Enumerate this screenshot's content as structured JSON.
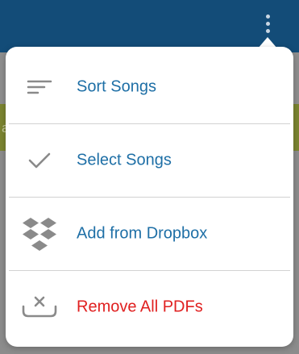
{
  "header": {
    "more_icon": "more-vertical-icon",
    "background_color": "#134c78"
  },
  "background": {
    "band_color": "#7b8430",
    "peek_text": "a"
  },
  "menu": {
    "items": [
      {
        "label": "Sort Songs",
        "icon": "sort-icon",
        "color": "#1e6fa6"
      },
      {
        "label": "Select Songs",
        "icon": "checkmark-icon",
        "color": "#1e6fa6"
      },
      {
        "label": "Add from Dropbox",
        "icon": "dropbox-icon",
        "color": "#1e6fa6"
      },
      {
        "label": "Remove All PDFs",
        "icon": "remove-tray-icon",
        "color": "#e02020"
      }
    ]
  }
}
